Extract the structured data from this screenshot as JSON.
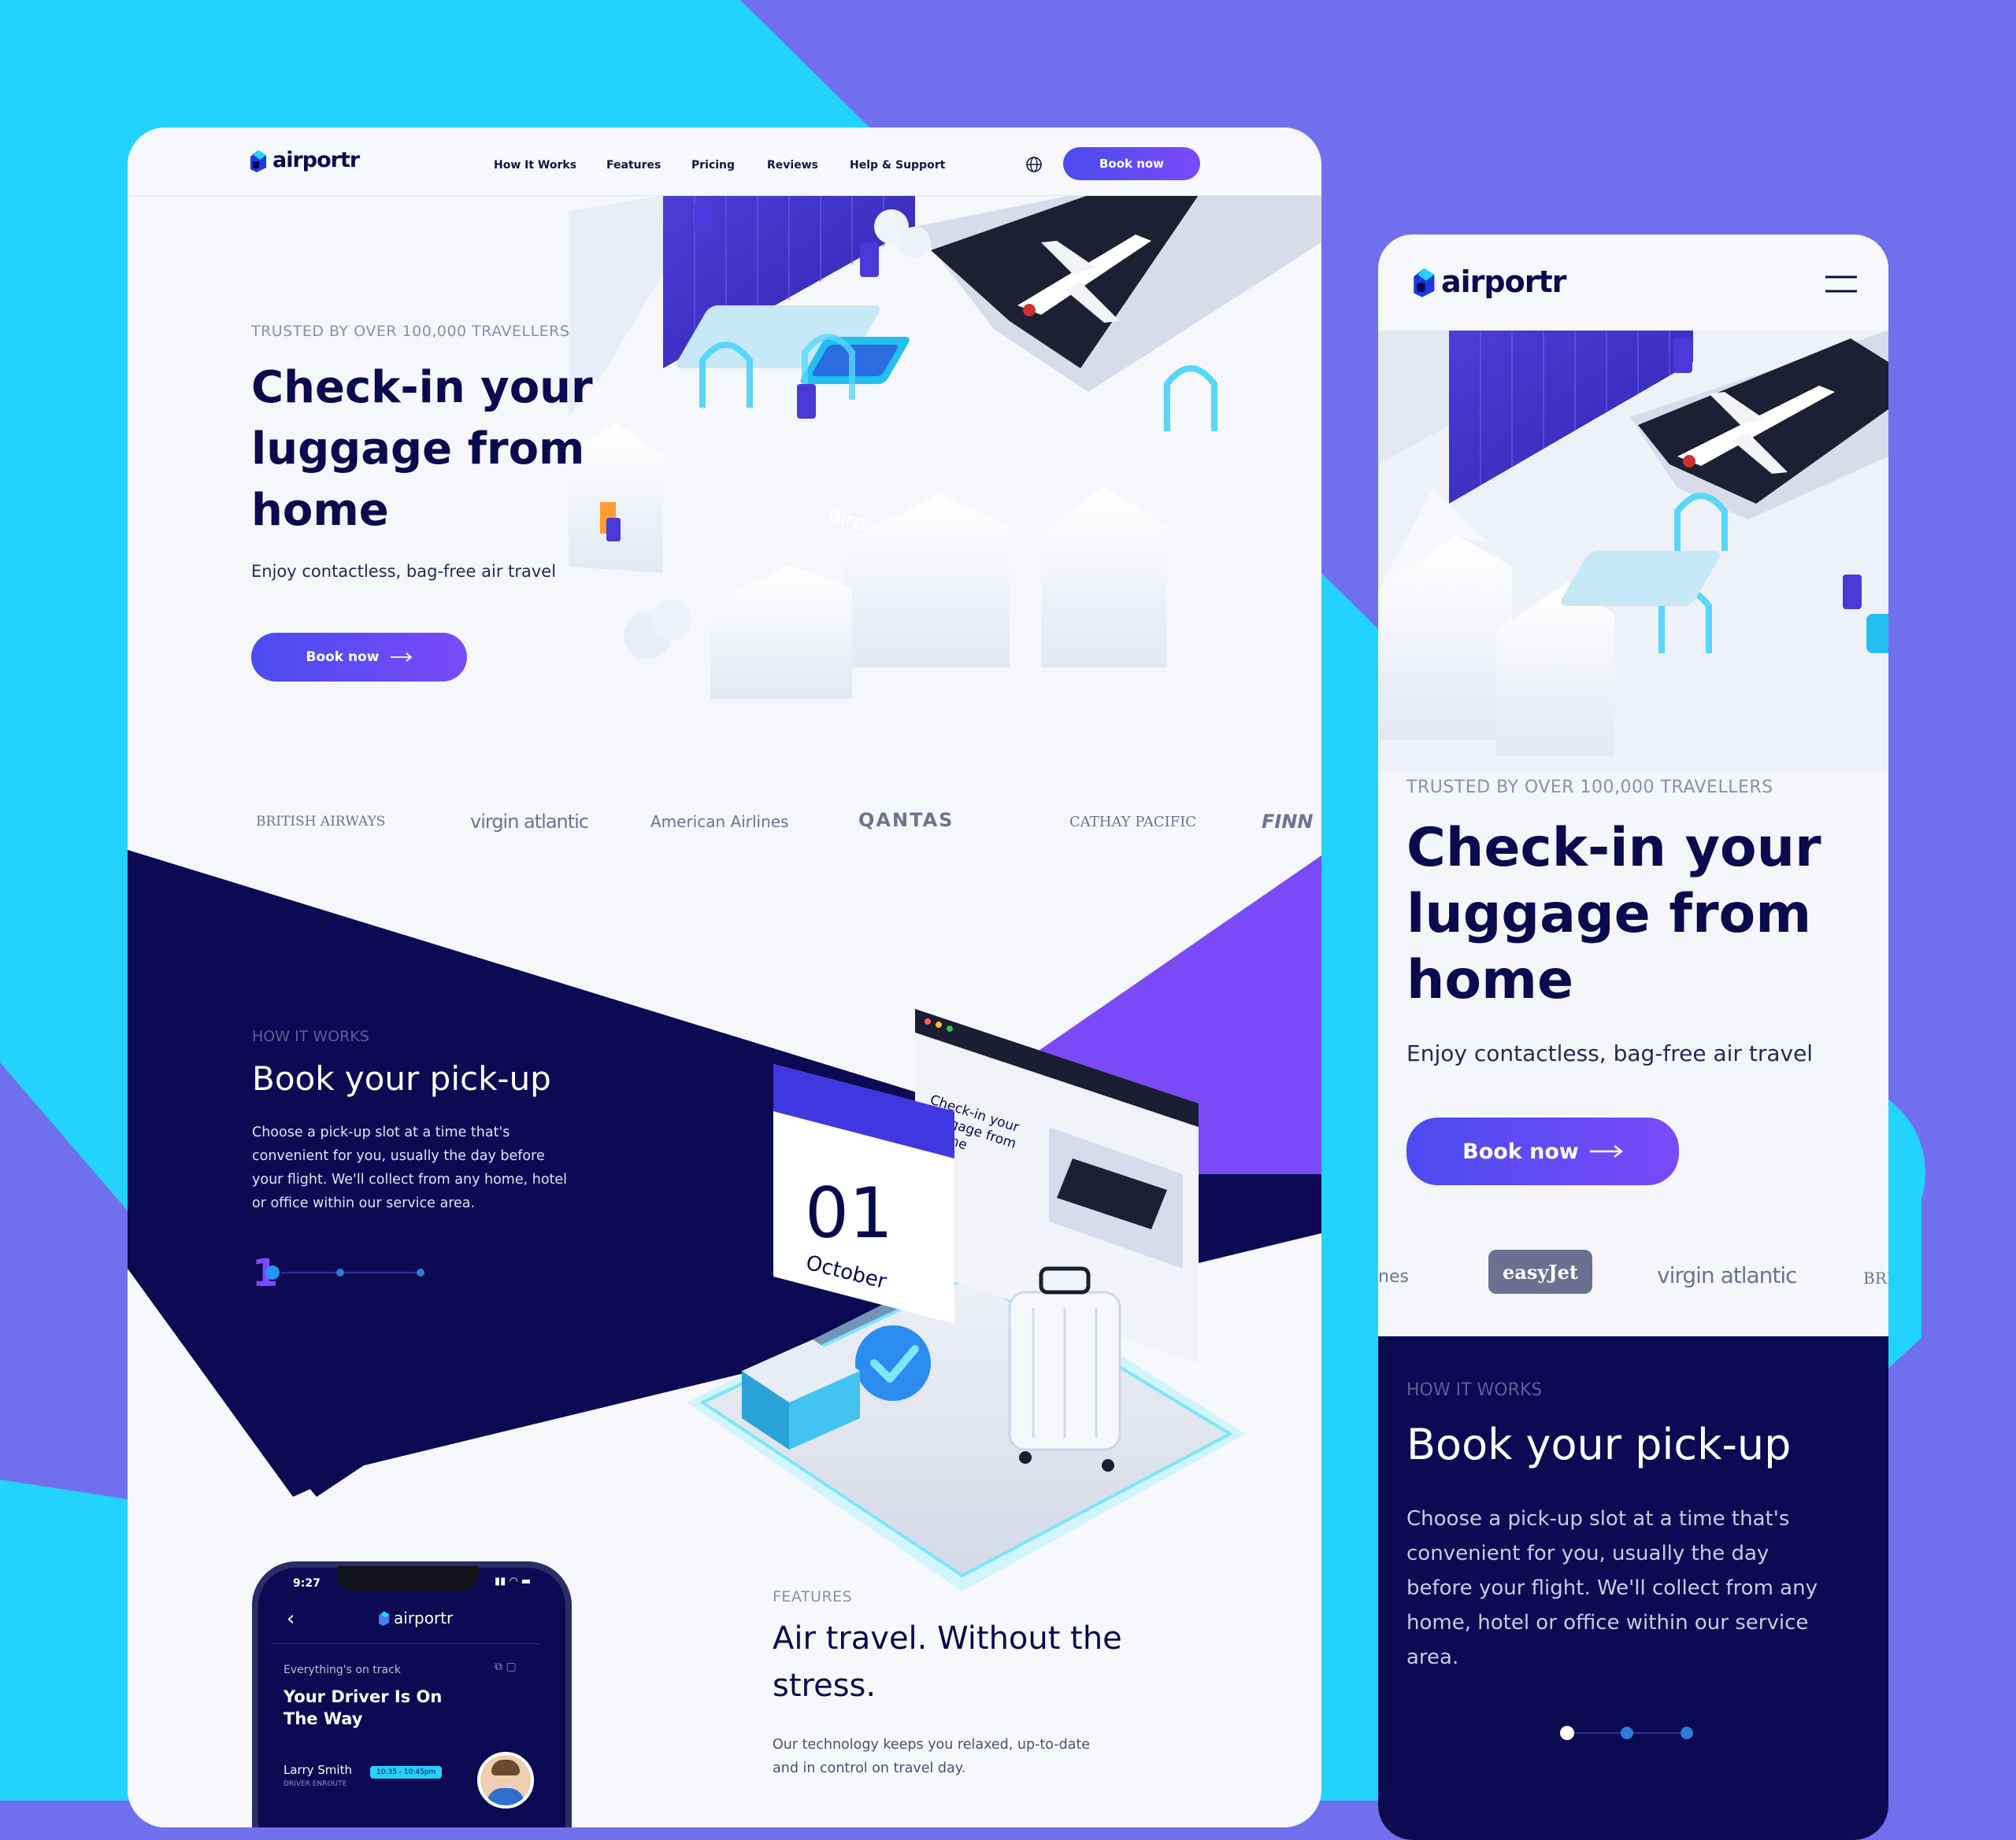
{
  "brand": {
    "name": "airportr"
  },
  "desktop": {
    "nav": {
      "items": [
        "How It Works",
        "Features",
        "Pricing",
        "Reviews",
        "Help & Support"
      ],
      "language_icon": "globe-icon",
      "cta": "Book now"
    },
    "hero": {
      "eyebrow": "TRUSTED BY OVER 100,000 TRAVELLERS",
      "title_lines": [
        "Check-in your",
        "luggage from",
        "home"
      ],
      "subtitle": "Enjoy contactless, bag-free air travel",
      "cta": "Book now",
      "illustration_sign": "airportr"
    },
    "airlines": [
      "BRITISH AIRWAYS",
      "virgin atlantic",
      "American Airlines",
      "QANTAS",
      "CATHAY PACIFIC",
      "FINN"
    ],
    "how_it_works": {
      "eyebrow": "HOW IT WORKS",
      "title": "Book your pick-up",
      "body_lines": [
        "Choose a pick-up slot at a time that's",
        "convenient for you, usually the day before",
        "your flight. We'll collect from any home, hotel",
        "or office within our service area."
      ],
      "step_number": "1",
      "calendar_day": "01",
      "calendar_month": "October",
      "screen_text_lines": [
        "Check-in your",
        "luggage from",
        "home"
      ]
    },
    "phone": {
      "time": "9:27",
      "status_title": "Everything's on track",
      "headline_lines": [
        "Your Driver Is On",
        "The Way"
      ],
      "driver_name": "Larry Smith",
      "driver_status": "DRIVER ENROUTE",
      "time_slot": "10:35 - 10:45pm"
    },
    "features": {
      "eyebrow": "FEATURES",
      "title_lines": [
        "Air travel. Without the",
        "stress."
      ],
      "body_lines": [
        "Our technology keeps you relaxed, up-to-date",
        "and in control on travel day."
      ]
    }
  },
  "mobile": {
    "menu_icon": "hamburger-menu-icon",
    "hero": {
      "eyebrow": "TRUSTED BY OVER 100,000 TRAVELLERS",
      "title_lines": [
        "Check-in your",
        "luggage from",
        "home"
      ],
      "subtitle": "Enjoy contactless, bag-free air travel",
      "cta": "Book now"
    },
    "airlines": [
      "nes",
      "easyJet",
      "virgin atlantic",
      "BRI"
    ],
    "how_it_works": {
      "eyebrow": "HOW IT WORKS",
      "title": "Book your pick-up",
      "body_lines": [
        "Choose a pick-up slot at a time that's",
        "convenient for you, usually the day",
        "before your flight. We'll collect from any",
        "home, hotel or office within our service",
        "area."
      ]
    }
  },
  "colors": {
    "cyan": "#22d3fe",
    "violet_bg": "#7070ee",
    "navy": "#0b0a4e",
    "purple": "#7b4af7",
    "button": "#4f4cf3"
  }
}
